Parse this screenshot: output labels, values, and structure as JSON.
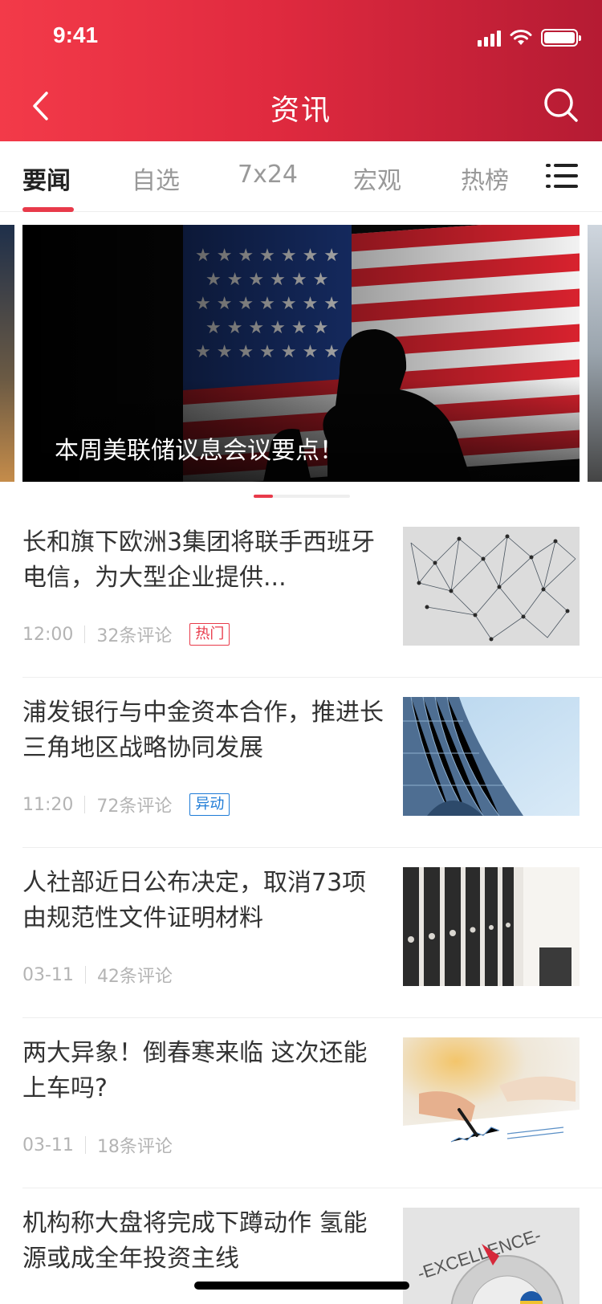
{
  "status_bar": {
    "time": "9:41"
  },
  "header": {
    "title": "资讯",
    "back_icon": "chevron-left-icon",
    "search_icon": "search-icon"
  },
  "tabs": {
    "items": [
      {
        "label": "要闻",
        "active": true
      },
      {
        "label": "自选",
        "active": false
      },
      {
        "label": "7x24",
        "active": false
      },
      {
        "label": "宏观",
        "active": false
      },
      {
        "label": "热榜",
        "active": false
      }
    ],
    "menu_icon": "list-menu-icon"
  },
  "banner": {
    "caption": "本周美联储议息会议要点！",
    "page_index": 1,
    "page_count": 5
  },
  "news": [
    {
      "title": "长和旗下欧洲3集团将联手西班牙电信，为大型企业提供...",
      "time": "12:00",
      "comments": "32条评论",
      "badge": "热门",
      "badge_type": "hot"
    },
    {
      "title": "浦发银行与中金资本合作，推进长三角地区战略协同发展",
      "time": "11:20",
      "comments": "72条评论",
      "badge": "异动",
      "badge_type": "move"
    },
    {
      "title": "人社部近日公布决定，取消73项由规范性文件证明材料",
      "time": "03-11",
      "comments": "42条评论",
      "badge": "",
      "badge_type": ""
    },
    {
      "title": "两大异象！倒春寒来临  这次还能上车吗?",
      "time": "03-11",
      "comments": "18条评论",
      "badge": "",
      "badge_type": ""
    },
    {
      "title": "机构称大盘将完成下蹲动作  氢能源或成全年投资主线",
      "time": "",
      "comments": "",
      "badge": "",
      "badge_type": ""
    }
  ],
  "colors": {
    "accent": "#e83a4a",
    "header_start": "#f33a49",
    "header_end": "#b51b33",
    "badge_blue": "#1e7bd6"
  }
}
